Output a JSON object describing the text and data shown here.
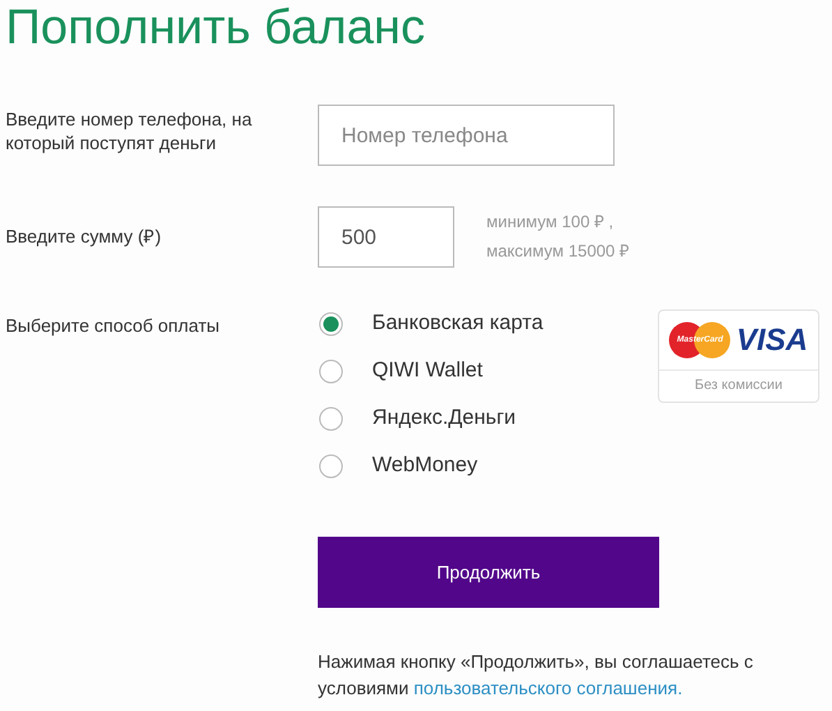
{
  "title": "Пополнить баланс",
  "phone": {
    "label": "Введите номер телефона, на который поступят деньги",
    "placeholder": "Номер телефона"
  },
  "amount": {
    "label": "Введите сумму (₽)",
    "value": "500",
    "hint_min": "минимум 100 ₽ ,",
    "hint_max": "максимум 15000 ₽"
  },
  "payment": {
    "label": "Выберите способ оплаты",
    "options": [
      {
        "label": "Банковская карта",
        "selected": true
      },
      {
        "label": "QIWI Wallet",
        "selected": false
      },
      {
        "label": "Яндекс.Деньги",
        "selected": false
      },
      {
        "label": "WebMoney",
        "selected": false
      }
    ],
    "card_badge": {
      "mastercard": "MasterCard",
      "visa": "VISA",
      "note": "Без комиссии"
    }
  },
  "submit": "Продолжить",
  "agreement": {
    "text": "Нажимая кнопку «Продолжить», вы соглашаетесь с условиями",
    "link": "пользовательского соглашения."
  }
}
